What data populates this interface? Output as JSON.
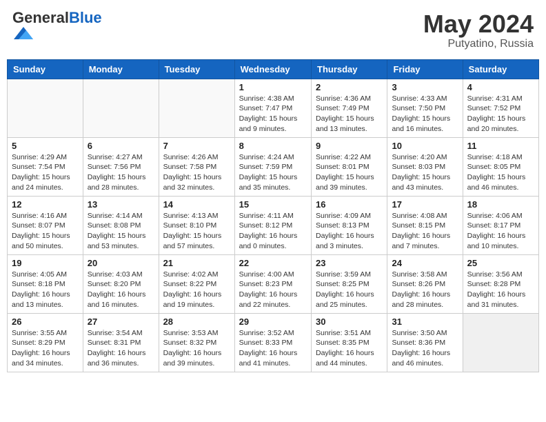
{
  "header": {
    "logo_general": "General",
    "logo_blue": "Blue",
    "title": "May 2024",
    "location": "Putyatino, Russia"
  },
  "weekdays": [
    "Sunday",
    "Monday",
    "Tuesday",
    "Wednesday",
    "Thursday",
    "Friday",
    "Saturday"
  ],
  "weeks": [
    [
      {
        "day": "",
        "info": ""
      },
      {
        "day": "",
        "info": ""
      },
      {
        "day": "",
        "info": ""
      },
      {
        "day": "1",
        "info": "Sunrise: 4:38 AM\nSunset: 7:47 PM\nDaylight: 15 hours\nand 9 minutes."
      },
      {
        "day": "2",
        "info": "Sunrise: 4:36 AM\nSunset: 7:49 PM\nDaylight: 15 hours\nand 13 minutes."
      },
      {
        "day": "3",
        "info": "Sunrise: 4:33 AM\nSunset: 7:50 PM\nDaylight: 15 hours\nand 16 minutes."
      },
      {
        "day": "4",
        "info": "Sunrise: 4:31 AM\nSunset: 7:52 PM\nDaylight: 15 hours\nand 20 minutes."
      }
    ],
    [
      {
        "day": "5",
        "info": "Sunrise: 4:29 AM\nSunset: 7:54 PM\nDaylight: 15 hours\nand 24 minutes."
      },
      {
        "day": "6",
        "info": "Sunrise: 4:27 AM\nSunset: 7:56 PM\nDaylight: 15 hours\nand 28 minutes."
      },
      {
        "day": "7",
        "info": "Sunrise: 4:26 AM\nSunset: 7:58 PM\nDaylight: 15 hours\nand 32 minutes."
      },
      {
        "day": "8",
        "info": "Sunrise: 4:24 AM\nSunset: 7:59 PM\nDaylight: 15 hours\nand 35 minutes."
      },
      {
        "day": "9",
        "info": "Sunrise: 4:22 AM\nSunset: 8:01 PM\nDaylight: 15 hours\nand 39 minutes."
      },
      {
        "day": "10",
        "info": "Sunrise: 4:20 AM\nSunset: 8:03 PM\nDaylight: 15 hours\nand 43 minutes."
      },
      {
        "day": "11",
        "info": "Sunrise: 4:18 AM\nSunset: 8:05 PM\nDaylight: 15 hours\nand 46 minutes."
      }
    ],
    [
      {
        "day": "12",
        "info": "Sunrise: 4:16 AM\nSunset: 8:07 PM\nDaylight: 15 hours\nand 50 minutes."
      },
      {
        "day": "13",
        "info": "Sunrise: 4:14 AM\nSunset: 8:08 PM\nDaylight: 15 hours\nand 53 minutes."
      },
      {
        "day": "14",
        "info": "Sunrise: 4:13 AM\nSunset: 8:10 PM\nDaylight: 15 hours\nand 57 minutes."
      },
      {
        "day": "15",
        "info": "Sunrise: 4:11 AM\nSunset: 8:12 PM\nDaylight: 16 hours\nand 0 minutes."
      },
      {
        "day": "16",
        "info": "Sunrise: 4:09 AM\nSunset: 8:13 PM\nDaylight: 16 hours\nand 3 minutes."
      },
      {
        "day": "17",
        "info": "Sunrise: 4:08 AM\nSunset: 8:15 PM\nDaylight: 16 hours\nand 7 minutes."
      },
      {
        "day": "18",
        "info": "Sunrise: 4:06 AM\nSunset: 8:17 PM\nDaylight: 16 hours\nand 10 minutes."
      }
    ],
    [
      {
        "day": "19",
        "info": "Sunrise: 4:05 AM\nSunset: 8:18 PM\nDaylight: 16 hours\nand 13 minutes."
      },
      {
        "day": "20",
        "info": "Sunrise: 4:03 AM\nSunset: 8:20 PM\nDaylight: 16 hours\nand 16 minutes."
      },
      {
        "day": "21",
        "info": "Sunrise: 4:02 AM\nSunset: 8:22 PM\nDaylight: 16 hours\nand 19 minutes."
      },
      {
        "day": "22",
        "info": "Sunrise: 4:00 AM\nSunset: 8:23 PM\nDaylight: 16 hours\nand 22 minutes."
      },
      {
        "day": "23",
        "info": "Sunrise: 3:59 AM\nSunset: 8:25 PM\nDaylight: 16 hours\nand 25 minutes."
      },
      {
        "day": "24",
        "info": "Sunrise: 3:58 AM\nSunset: 8:26 PM\nDaylight: 16 hours\nand 28 minutes."
      },
      {
        "day": "25",
        "info": "Sunrise: 3:56 AM\nSunset: 8:28 PM\nDaylight: 16 hours\nand 31 minutes."
      }
    ],
    [
      {
        "day": "26",
        "info": "Sunrise: 3:55 AM\nSunset: 8:29 PM\nDaylight: 16 hours\nand 34 minutes."
      },
      {
        "day": "27",
        "info": "Sunrise: 3:54 AM\nSunset: 8:31 PM\nDaylight: 16 hours\nand 36 minutes."
      },
      {
        "day": "28",
        "info": "Sunrise: 3:53 AM\nSunset: 8:32 PM\nDaylight: 16 hours\nand 39 minutes."
      },
      {
        "day": "29",
        "info": "Sunrise: 3:52 AM\nSunset: 8:33 PM\nDaylight: 16 hours\nand 41 minutes."
      },
      {
        "day": "30",
        "info": "Sunrise: 3:51 AM\nSunset: 8:35 PM\nDaylight: 16 hours\nand 44 minutes."
      },
      {
        "day": "31",
        "info": "Sunrise: 3:50 AM\nSunset: 8:36 PM\nDaylight: 16 hours\nand 46 minutes."
      },
      {
        "day": "",
        "info": ""
      }
    ]
  ]
}
